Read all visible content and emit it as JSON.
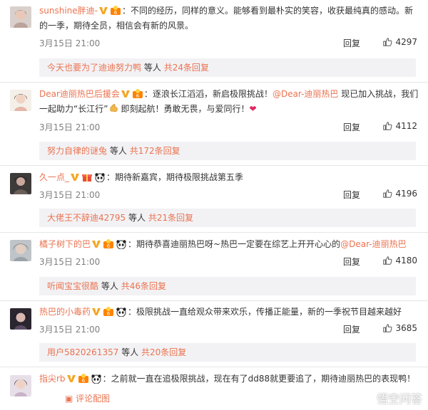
{
  "comments": [
    {
      "user": "sunshine胖迪-",
      "colon": "：",
      "text": "不同的经历，同样的意义。能够看到最朴实的笑容，收获最纯真的感动。新的一季，期待全员，相信会有新的风景。",
      "time": "3月15日 21:00",
      "reply_label": "回复",
      "likes": "4297",
      "sub_user": "今天也要为了迪迪努力鸭",
      "sub_etc": "等人",
      "sub_total": "共24条回复"
    },
    {
      "user": "Dear迪丽热巴后援会",
      "colon": "：",
      "text_a": "逐浪长江滔滔，新启极限挑战！",
      "mention": "@Dear-迪丽热巴",
      "text_b": " 现已加入挑战，我们一起助力“长江行”",
      "text_c": "即刻起航！勇敢无畏，与爱同行！",
      "time": "3月15日 21:00",
      "reply_label": "回复",
      "likes": "4112",
      "sub_user": "努力自律的谜兔",
      "sub_etc": "等人",
      "sub_total": "共172条回复"
    },
    {
      "user": "久一点_",
      "colon": "：",
      "text": "期待新嘉宾，期待极限挑战第五季",
      "time": "3月15日 21:00",
      "reply_label": "回复",
      "likes": "4196",
      "sub_user": "大佬王不辞迪42795",
      "sub_etc": "等人",
      "sub_total": "共21条回复"
    },
    {
      "user": "橘子树下的巴",
      "colon": "：",
      "text": "期待恭喜迪丽热巴呀~热巴一定要在综艺上开开心心的",
      "mention": "@Dear-迪丽热巴",
      "time": "3月15日 21:00",
      "reply_label": "回复",
      "likes": "4180",
      "sub_user": "听闻宝宝很酷",
      "sub_etc": "等人",
      "sub_total": "共46条回复"
    },
    {
      "user": "热巴的小毒药",
      "colon": "：",
      "text": "极限挑战一直给观众带来欢乐，传播正能量，新的一季祝节目越来越好",
      "time": "3月15日 21:00",
      "reply_label": "回复",
      "likes": "3685",
      "sub_user": "用户5820261357",
      "sub_etc": "等人",
      "sub_total": "共20条回复"
    },
    {
      "user": "指尖rb",
      "colon": "：",
      "text": "之前就一直在追极限挑战，现在有了dd88就更要追了，期待迪丽热巴的表现鸭！",
      "pic_label": "评论配图"
    }
  ],
  "watermark": "悟空问答",
  "colors": {
    "username": "#eb7350",
    "meta": "#808080",
    "subbox_bg": "#f2f2f5",
    "heart": "#e0245e"
  }
}
